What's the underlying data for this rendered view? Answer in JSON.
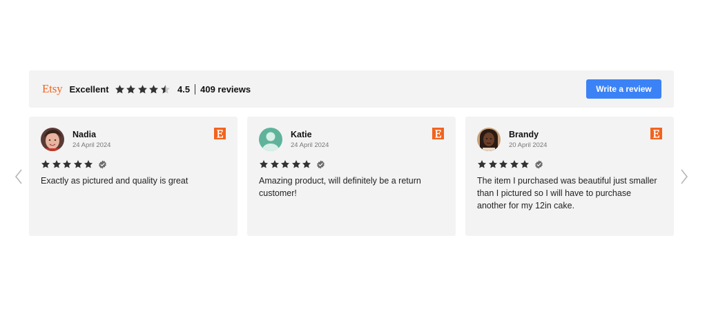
{
  "header": {
    "brand": "Etsy",
    "rating_word": "Excellent",
    "rating_value": 4.5,
    "score_text": "4.5",
    "review_count_text": "409 reviews",
    "write_button_label": "Write a review",
    "colors": {
      "brand": "#f1641e",
      "button": "#3b82f6",
      "star": "#333333"
    }
  },
  "navigation": {
    "prev_icon": "chevron-left-icon",
    "next_icon": "chevron-right-icon"
  },
  "reviews": [
    {
      "name": "Nadia",
      "date": "24 April 2024",
      "stars": 5,
      "verified": true,
      "source_icon": "etsy-icon",
      "text": "Exactly as pictured and quality is great"
    },
    {
      "name": "Katie",
      "date": "24 April 2024",
      "stars": 5,
      "verified": true,
      "source_icon": "etsy-icon",
      "text": "Amazing product, will definitely be a return customer!"
    },
    {
      "name": "Brandy",
      "date": "20 April 2024",
      "stars": 5,
      "verified": true,
      "source_icon": "etsy-icon",
      "text": "The item I purchased was beautiful just smaller than I pictured so I will have to purchase another for my 12in cake."
    }
  ]
}
